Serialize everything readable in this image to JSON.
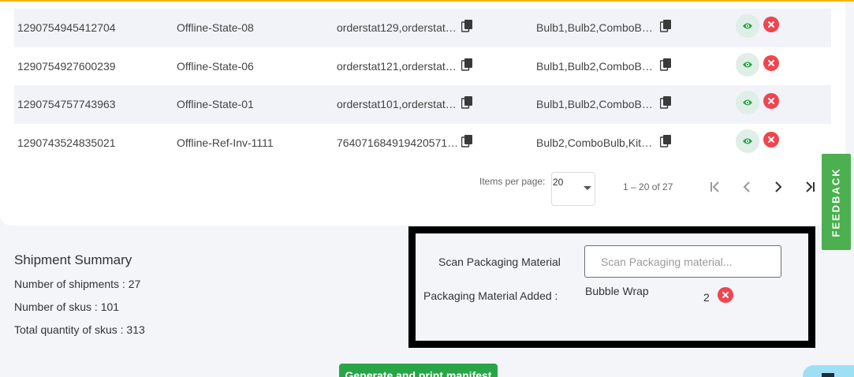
{
  "colors": {
    "accent_bar": "#f5b400",
    "view_button_bg": "#dfeee6",
    "view_icon": "#27a547",
    "delete_icon": "#f0454f",
    "feedback_bg": "#4caf50",
    "manifest_button_bg": "#27a547"
  },
  "table": {
    "rows": [
      {
        "shipment_id": "1290754945412704",
        "reference": "Offline-State-08",
        "orders": "orderstat129,orderstat1…",
        "skus": "Bulb1,Bulb2,ComboBul…"
      },
      {
        "shipment_id": "1290754927600239",
        "reference": "Offline-State-06",
        "orders": "orderstat121,orderstat1…",
        "skus": "Bulb1,Bulb2,ComboBul…"
      },
      {
        "shipment_id": "1290754757743963",
        "reference": "Offline-State-01",
        "orders": "orderstat101,orderstat1…",
        "skus": "Bulb1,Bulb2,ComboBul…"
      },
      {
        "shipment_id": "1290743524835021",
        "reference": "Offline-Ref-Inv-1111",
        "orders": "764071684919420571…",
        "skus": "Bulb2,ComboBulb,KitBu…"
      }
    ],
    "row_icons": {
      "copy": "copy-icon",
      "view": "eye-icon",
      "delete": "close-circle-icon"
    }
  },
  "pagination": {
    "items_per_page_label": "Items per page:",
    "items_per_page_value": "20",
    "range_label": "1 – 20 of 27",
    "icons": [
      "first-page-icon",
      "previous-page-icon",
      "next-page-icon",
      "last-page-icon"
    ]
  },
  "feedback": {
    "label": "FEEDBACK"
  },
  "summary": {
    "title": "Shipment Summary",
    "shipments": "Number of shipments :  27",
    "skus": "Number of skus :  101",
    "total_quantity": "Total quantity of skus : 313"
  },
  "packaging": {
    "scan_label": "Scan Packaging Material",
    "scan_placeholder": "Scan Packaging material...",
    "added_label": "Packaging Material Added :",
    "items": [
      {
        "name": "Bubble Wrap",
        "quantity": "2"
      }
    ]
  },
  "actions": {
    "manifest_label": "Generate and print manifest"
  }
}
